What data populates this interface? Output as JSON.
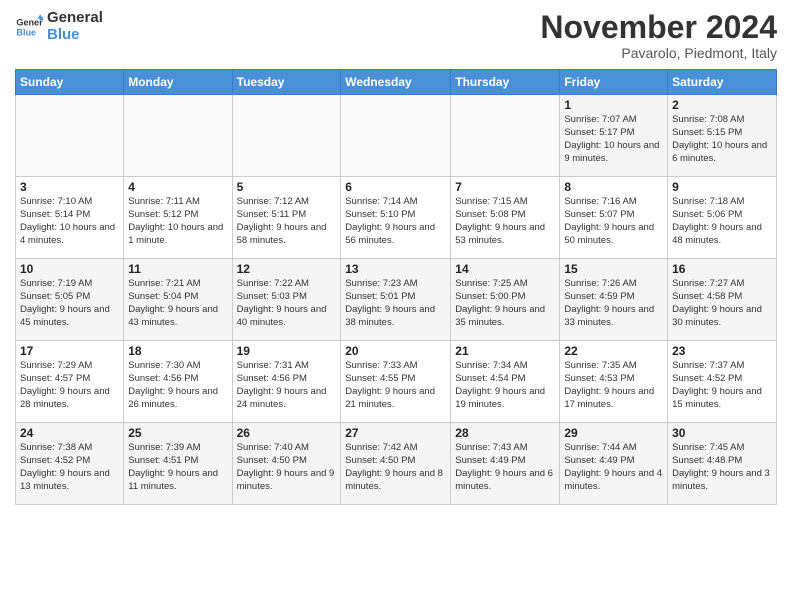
{
  "header": {
    "logo_line1": "General",
    "logo_line2": "Blue",
    "month": "November 2024",
    "location": "Pavarolo, Piedmont, Italy"
  },
  "weekdays": [
    "Sunday",
    "Monday",
    "Tuesday",
    "Wednesday",
    "Thursday",
    "Friday",
    "Saturday"
  ],
  "rows": [
    [
      {
        "day": "",
        "info": ""
      },
      {
        "day": "",
        "info": ""
      },
      {
        "day": "",
        "info": ""
      },
      {
        "day": "",
        "info": ""
      },
      {
        "day": "",
        "info": ""
      },
      {
        "day": "1",
        "info": "Sunrise: 7:07 AM\nSunset: 5:17 PM\nDaylight: 10 hours and 9 minutes."
      },
      {
        "day": "2",
        "info": "Sunrise: 7:08 AM\nSunset: 5:15 PM\nDaylight: 10 hours and 6 minutes."
      }
    ],
    [
      {
        "day": "3",
        "info": "Sunrise: 7:10 AM\nSunset: 5:14 PM\nDaylight: 10 hours and 4 minutes."
      },
      {
        "day": "4",
        "info": "Sunrise: 7:11 AM\nSunset: 5:12 PM\nDaylight: 10 hours and 1 minute."
      },
      {
        "day": "5",
        "info": "Sunrise: 7:12 AM\nSunset: 5:11 PM\nDaylight: 9 hours and 58 minutes."
      },
      {
        "day": "6",
        "info": "Sunrise: 7:14 AM\nSunset: 5:10 PM\nDaylight: 9 hours and 56 minutes."
      },
      {
        "day": "7",
        "info": "Sunrise: 7:15 AM\nSunset: 5:08 PM\nDaylight: 9 hours and 53 minutes."
      },
      {
        "day": "8",
        "info": "Sunrise: 7:16 AM\nSunset: 5:07 PM\nDaylight: 9 hours and 50 minutes."
      },
      {
        "day": "9",
        "info": "Sunrise: 7:18 AM\nSunset: 5:06 PM\nDaylight: 9 hours and 48 minutes."
      }
    ],
    [
      {
        "day": "10",
        "info": "Sunrise: 7:19 AM\nSunset: 5:05 PM\nDaylight: 9 hours and 45 minutes."
      },
      {
        "day": "11",
        "info": "Sunrise: 7:21 AM\nSunset: 5:04 PM\nDaylight: 9 hours and 43 minutes."
      },
      {
        "day": "12",
        "info": "Sunrise: 7:22 AM\nSunset: 5:03 PM\nDaylight: 9 hours and 40 minutes."
      },
      {
        "day": "13",
        "info": "Sunrise: 7:23 AM\nSunset: 5:01 PM\nDaylight: 9 hours and 38 minutes."
      },
      {
        "day": "14",
        "info": "Sunrise: 7:25 AM\nSunset: 5:00 PM\nDaylight: 9 hours and 35 minutes."
      },
      {
        "day": "15",
        "info": "Sunrise: 7:26 AM\nSunset: 4:59 PM\nDaylight: 9 hours and 33 minutes."
      },
      {
        "day": "16",
        "info": "Sunrise: 7:27 AM\nSunset: 4:58 PM\nDaylight: 9 hours and 30 minutes."
      }
    ],
    [
      {
        "day": "17",
        "info": "Sunrise: 7:29 AM\nSunset: 4:57 PM\nDaylight: 9 hours and 28 minutes."
      },
      {
        "day": "18",
        "info": "Sunrise: 7:30 AM\nSunset: 4:56 PM\nDaylight: 9 hours and 26 minutes."
      },
      {
        "day": "19",
        "info": "Sunrise: 7:31 AM\nSunset: 4:56 PM\nDaylight: 9 hours and 24 minutes."
      },
      {
        "day": "20",
        "info": "Sunrise: 7:33 AM\nSunset: 4:55 PM\nDaylight: 9 hours and 21 minutes."
      },
      {
        "day": "21",
        "info": "Sunrise: 7:34 AM\nSunset: 4:54 PM\nDaylight: 9 hours and 19 minutes."
      },
      {
        "day": "22",
        "info": "Sunrise: 7:35 AM\nSunset: 4:53 PM\nDaylight: 9 hours and 17 minutes."
      },
      {
        "day": "23",
        "info": "Sunrise: 7:37 AM\nSunset: 4:52 PM\nDaylight: 9 hours and 15 minutes."
      }
    ],
    [
      {
        "day": "24",
        "info": "Sunrise: 7:38 AM\nSunset: 4:52 PM\nDaylight: 9 hours and 13 minutes."
      },
      {
        "day": "25",
        "info": "Sunrise: 7:39 AM\nSunset: 4:51 PM\nDaylight: 9 hours and 11 minutes."
      },
      {
        "day": "26",
        "info": "Sunrise: 7:40 AM\nSunset: 4:50 PM\nDaylight: 9 hours and 9 minutes."
      },
      {
        "day": "27",
        "info": "Sunrise: 7:42 AM\nSunset: 4:50 PM\nDaylight: 9 hours and 8 minutes."
      },
      {
        "day": "28",
        "info": "Sunrise: 7:43 AM\nSunset: 4:49 PM\nDaylight: 9 hours and 6 minutes."
      },
      {
        "day": "29",
        "info": "Sunrise: 7:44 AM\nSunset: 4:49 PM\nDaylight: 9 hours and 4 minutes."
      },
      {
        "day": "30",
        "info": "Sunrise: 7:45 AM\nSunset: 4:48 PM\nDaylight: 9 hours and 3 minutes."
      }
    ]
  ]
}
